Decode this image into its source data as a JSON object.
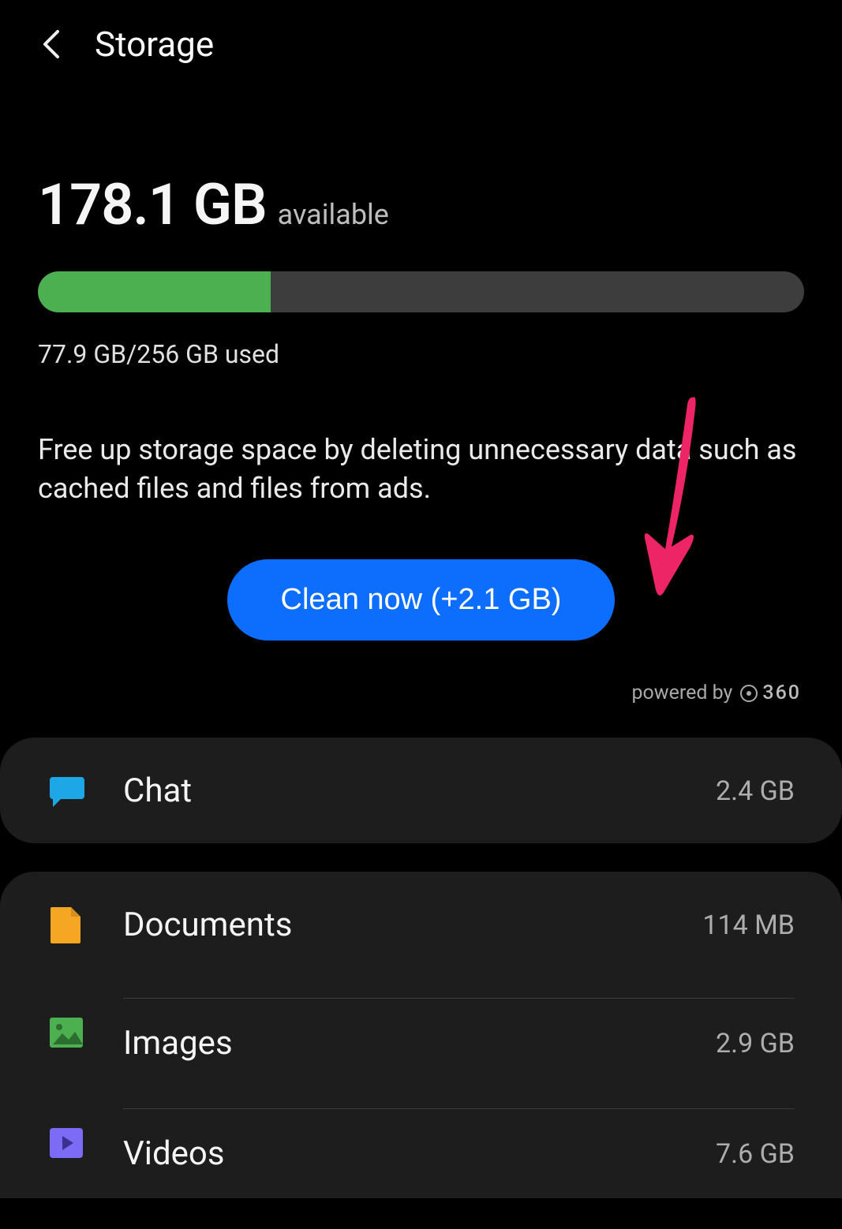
{
  "header": {
    "title": "Storage"
  },
  "storage": {
    "available_amount": "178.1 GB",
    "available_label": "available",
    "used_text": "77.9 GB/256 GB used",
    "used_gb": 77.9,
    "total_gb": 256,
    "fill_percent": 30.4,
    "description": "Free up storage space by deleting unnecessary data such as cached files and files from ads.",
    "clean_button_label": "Clean now (+2.1 GB)",
    "powered_by_prefix": "powered by",
    "powered_by_brand": "360"
  },
  "categories_group1": [
    {
      "name": "Chat",
      "size": "2.4 GB",
      "icon": "chat",
      "color": "#1ea7e6"
    }
  ],
  "categories_group2": [
    {
      "name": "Documents",
      "size": "114 MB",
      "icon": "document",
      "color": "#f5a623"
    },
    {
      "name": "Images",
      "size": "2.9 GB",
      "icon": "image",
      "color": "#4caf50"
    },
    {
      "name": "Videos",
      "size": "7.6 GB",
      "icon": "video",
      "color": "#7c6cf5"
    }
  ],
  "colors": {
    "accent_blue": "#0d6efd",
    "progress_green": "#4caf50",
    "arrow_pink": "#ed2465"
  }
}
